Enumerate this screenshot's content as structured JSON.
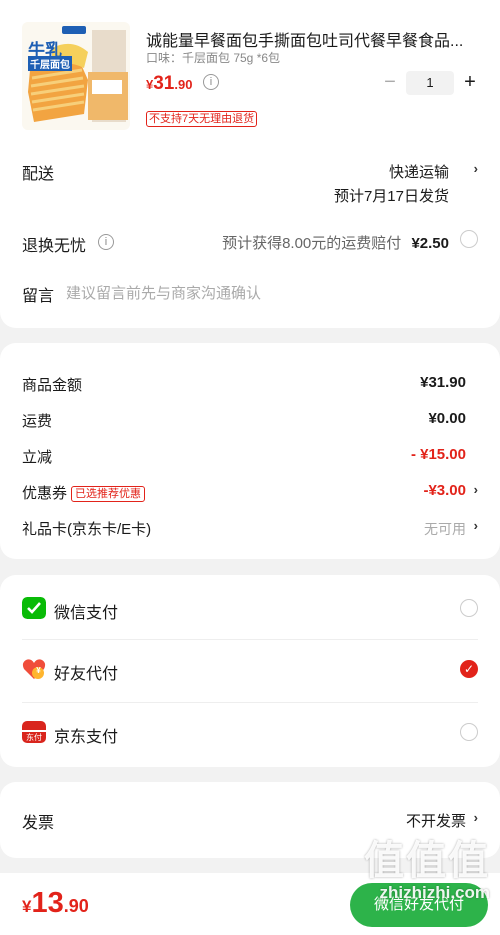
{
  "product": {
    "title": "诚能量早餐面包手撕面包吐司代餐早餐食品...",
    "spec": "口味：千层面包 75g *6包",
    "price_currency": "¥",
    "price_int": "31",
    "price_dec": ".90",
    "info_glyph": "i",
    "qty": "1",
    "minus": "−",
    "plus": "+",
    "tag": "不支持7天无理由退货",
    "thumb_text_main": "牛乳",
    "thumb_text_sub": "千层面包"
  },
  "delivery": {
    "label": "配送",
    "method": "快递运输",
    "date": "预计7月17日发货"
  },
  "return": {
    "label": "退换无忧",
    "info_glyph": "i",
    "desc": "预计获得8.00元的运费赔付",
    "price": "¥2.50"
  },
  "note": {
    "label": "留言",
    "placeholder": "建议留言前先与商家沟通确认"
  },
  "summary": {
    "items": [
      {
        "label": "商品金额",
        "value": "¥31.90"
      },
      {
        "label": "运费",
        "value": "¥0.00"
      },
      {
        "label": "立减",
        "value": "- ¥15.00"
      },
      {
        "label": "优惠券",
        "tag": "已选推荐优惠",
        "value": "-¥3.00"
      },
      {
        "label": "礼品卡(京东卡/E卡)",
        "value": "无可用"
      }
    ]
  },
  "payment": {
    "options": [
      {
        "label": "微信支付",
        "icon": "wechat-pay-icon",
        "selected": false
      },
      {
        "label": "好友代付",
        "icon": "friend-pay-icon",
        "selected": true
      },
      {
        "label": "京东支付",
        "icon": "jd-pay-icon",
        "selected": false
      }
    ],
    "jd_icon_text": "东付",
    "friend_icon_text": "¥",
    "check_glyph": "✓"
  },
  "invoice": {
    "label": "发票",
    "value": "不开发票"
  },
  "chevron": "›",
  "bottom": {
    "currency": "¥",
    "total_int": "13",
    "total_dec": ".90",
    "submit": "微信好友代付"
  },
  "watermark": {
    "big": "值值值",
    "small": "zhizhizhi.com"
  },
  "colors": {
    "accent": "#e2231a",
    "wechat_green": "#09bb07",
    "submit_green": "#2db34a"
  }
}
